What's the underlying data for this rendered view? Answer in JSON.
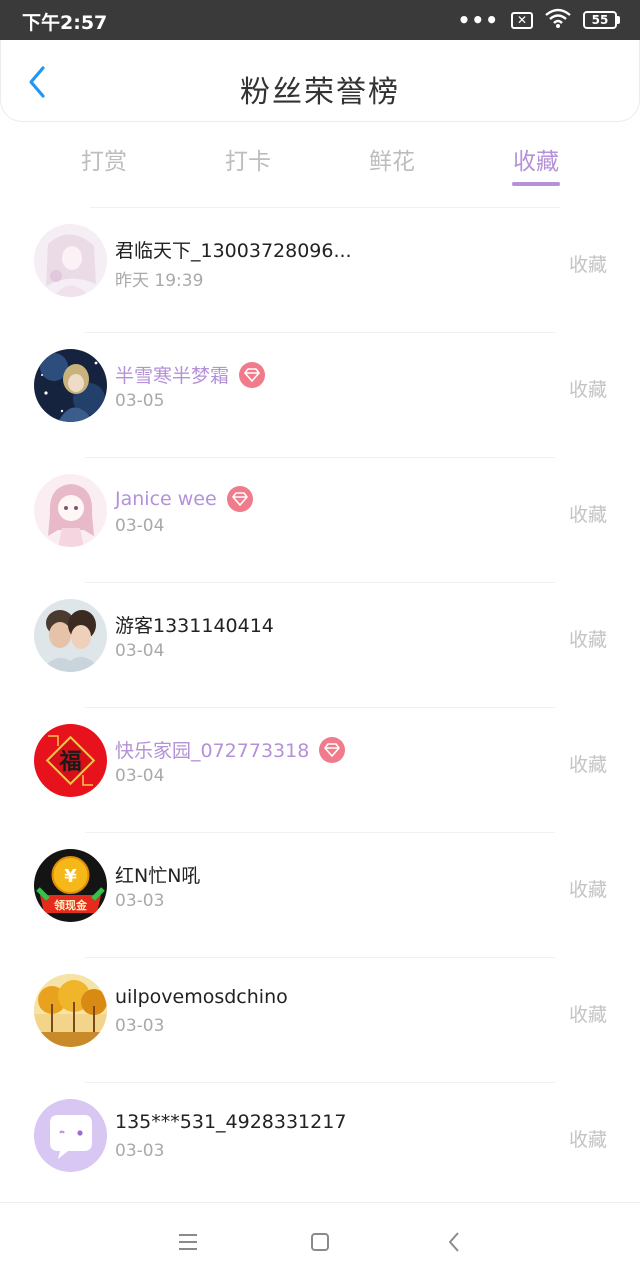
{
  "status_bar": {
    "time": "下午2:57",
    "dots": "•••",
    "sim": "✕",
    "battery": "55"
  },
  "header": {
    "title": "粉丝荣誉榜"
  },
  "tabs": [
    {
      "label": "打赏"
    },
    {
      "label": "打卡"
    },
    {
      "label": "鲜花"
    },
    {
      "label": "收藏"
    }
  ],
  "active_tab": "收藏",
  "accent_color": "#b491d8",
  "list": [
    {
      "name": "君临天下_13003728096...",
      "date": "昨天 19:39",
      "action": "收藏",
      "vip": false,
      "avatar": "pink-anime-girl"
    },
    {
      "name": "半雪寒半梦霜",
      "date": "03-05",
      "action": "收藏",
      "vip": true,
      "avatar": "night-sky-anime"
    },
    {
      "name": "Janice wee",
      "date": "03-04",
      "action": "收藏",
      "vip": true,
      "avatar": "chibi-girl"
    },
    {
      "name": "游客1331140414",
      "date": "03-04",
      "action": "收藏",
      "vip": false,
      "avatar": "couple-photo"
    },
    {
      "name": "快乐家园_072773318",
      "date": "03-04",
      "action": "收藏",
      "vip": true,
      "avatar": "fu-character-red"
    },
    {
      "name": "红N忙N吼",
      "date": "03-03",
      "action": "收藏",
      "vip": false,
      "avatar": "cash-coin"
    },
    {
      "name": "uilpovemosdchino",
      "date": "03-03",
      "action": "收藏",
      "vip": false,
      "avatar": "autumn-trees"
    },
    {
      "name": "135***531_4928331217",
      "date": "03-03",
      "action": "收藏",
      "vip": false,
      "avatar": "chat-bubble-default"
    }
  ],
  "avatar_texts": {
    "fu": "福",
    "yen": "¥",
    "cash": "领现金"
  }
}
